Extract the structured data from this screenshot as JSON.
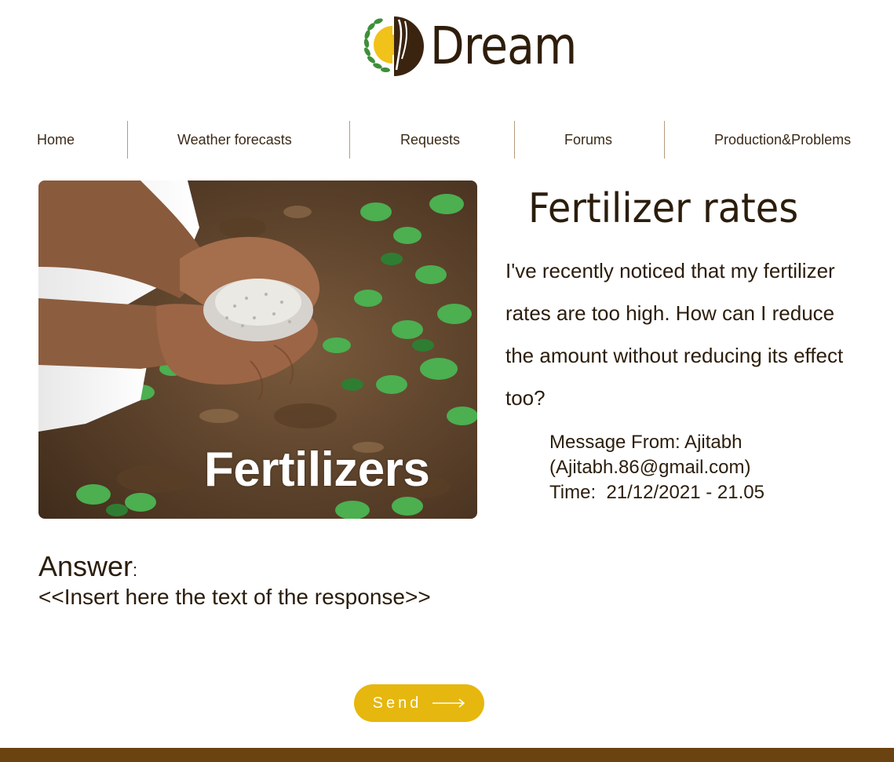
{
  "header": {
    "logo_text": "Dream",
    "logo_icon": "wheat-sun-icon"
  },
  "nav": {
    "items": [
      {
        "label": "Home"
      },
      {
        "label": "Weather forecasts"
      },
      {
        "label": "Requests"
      },
      {
        "label": "Forums"
      },
      {
        "label": "Production&Problems"
      }
    ]
  },
  "hero": {
    "caption": "Fertilizers",
    "image": "hands-holding-fertilizer-image"
  },
  "post": {
    "title": "Fertilizer rates",
    "question": "I've recently noticed that my fertilizer rates are too high. How can I reduce the amount without reducing its effect too?",
    "from_line": "Message From: Ajitabh",
    "email_line": "(Ajitabh.86@gmail.com)",
    "time_line": "Time:  21/12/2021 - 21.05"
  },
  "answer": {
    "label": "Answer",
    "colon": ":",
    "placeholder": "<<Insert here the text of the response>>"
  },
  "send": {
    "label": "Send",
    "icon": "long-arrow-right-icon"
  },
  "colors": {
    "accent": "#e6b70e",
    "footer": "#6b4310",
    "text": "#2b1d0c",
    "logo_green": "#3e8f3a",
    "logo_brown": "#3a2410"
  }
}
